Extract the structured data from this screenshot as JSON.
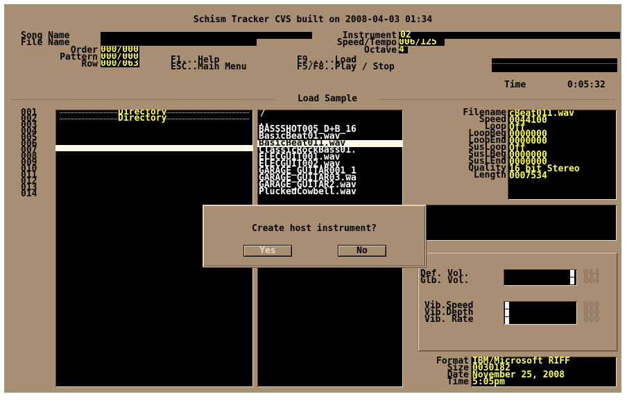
{
  "title": "Schism Tracker CVS built on 2008-04-03 01:34",
  "header": {
    "song_name_label": "Song Name",
    "file_name_label": "File Name",
    "order_label": "Order",
    "pattern_label": "Pattern",
    "row_label": "Row",
    "order_value": "000/000",
    "pattern_value": "000/000",
    "row_value": "000/063",
    "help1": "F1...Help",
    "help2": "ESC..Main Menu",
    "help3": "F9.....Load",
    "help4": "F5/F8..Play / Stop",
    "instrument_label": "Instrument",
    "instrument_value": "02",
    "speed_label": "Speed/Tempo",
    "speed_value": "006/125",
    "octave_label": "Octave",
    "octave_value": "4",
    "time_label": "Time",
    "time_value": "0:05:32"
  },
  "section_title": "Load Sample",
  "row_numbers": [
    "001",
    "002",
    "003",
    "004",
    "005",
    "006",
    "007",
    "008",
    "009",
    "010",
    "011",
    "012",
    "013",
    "014"
  ],
  "directories": [
    "Directory",
    "Directory"
  ],
  "files": {
    "path": "/",
    "items": [
      "..",
      "BASSSHOT005_D+B_16",
      "BasicBeat01.wav",
      "BasicBeat011.wav",
      "ClassicRockBass01.",
      "ELECGUIT001.wav",
      "ELECGUIT002.wav",
      "GARAGE_GUITAR001_1",
      "GARAGE_GUITAR03.wa",
      "GARAGE_GUITAR2.wav",
      "PluckedCowbell.wav"
    ],
    "selected_index": 3
  },
  "sample_info": {
    "labels": [
      "Filename",
      "Speed",
      "Loop",
      "LoopBeg",
      "LoopEnd",
      "SusLoop",
      "SusLBeg",
      "SusLEnd",
      "Quality",
      "Length"
    ],
    "values": [
      "cBeat011.wav",
      "0044100",
      "Off",
      "0000000",
      "0000000",
      "Off",
      "0000000",
      "0000000",
      "16 bit Stereo",
      "0007534"
    ]
  },
  "volume": {
    "def_label": "Def. Vol.",
    "glb_label": "Glb. Vol.",
    "def_value": "064",
    "glb_value": "064"
  },
  "vibrato": {
    "speed_label": "Vib.Speed",
    "depth_label": "Vib.Depth",
    "rate_label": "Vib. Rate",
    "speed_value": "000",
    "depth_value": "000",
    "rate_value": "000"
  },
  "format_info": {
    "format_label": "Format",
    "size_label": "Size",
    "date_label": "Date",
    "time_label": "Time",
    "format_value": "IBM/Microsoft RIFF",
    "size_value": "0030182",
    "date_value": "November 25, 2008",
    "time_value": "5:05pm"
  },
  "dialog": {
    "question": "Create host instrument?",
    "yes_label": "Yes",
    "no_label": "No"
  }
}
